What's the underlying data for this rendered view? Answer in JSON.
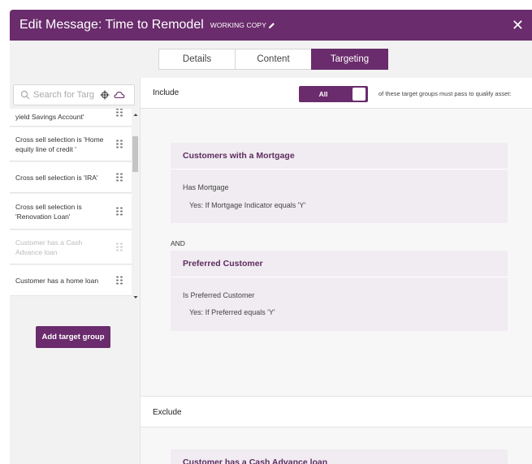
{
  "window": {
    "title": "Edit Message: Time to Remodel",
    "status": "WORKING COPY",
    "close_label": "✕"
  },
  "tabs": [
    {
      "label": "Details",
      "active": false
    },
    {
      "label": "Content",
      "active": false
    },
    {
      "label": "Targeting",
      "active": true
    }
  ],
  "sidebar": {
    "search_placeholder": "Search for Targ",
    "items": [
      {
        "label": "yield Savings Account'",
        "disabled": false
      },
      {
        "label": "Cross sell selection is 'Home equity line of credit '",
        "disabled": false
      },
      {
        "label": "Cross sell selection is 'IRA'",
        "disabled": false
      },
      {
        "label": "Cross sell selection is 'Renovation Loan'",
        "disabled": false
      },
      {
        "label": "Customer has a Cash Advance loan",
        "disabled": true
      },
      {
        "label": "Customer has a home loan",
        "disabled": false
      }
    ],
    "add_button": "Add target group"
  },
  "include": {
    "label": "Include",
    "toggle_label": "All",
    "qualify_text": "of these target groups must pass to qualify asset:",
    "operator": "AND",
    "groups": [
      {
        "name": "Customers with a Mortgage",
        "condition": "Has Mortgage",
        "detail": "Yes:  If Mortgage Indicator equals 'Y'"
      },
      {
        "name": "Preferred Customer",
        "condition": "Is Preferred Customer",
        "detail": "Yes:  If Preferred equals 'Y'"
      }
    ]
  },
  "exclude": {
    "label": "Exclude",
    "groups": [
      {
        "name": "Customer has a Cash Advance loan"
      }
    ]
  },
  "colors": {
    "brand": "#6a2c6c",
    "card_bg": "#f0ecf1",
    "panel_bg": "#f2f2f2"
  }
}
